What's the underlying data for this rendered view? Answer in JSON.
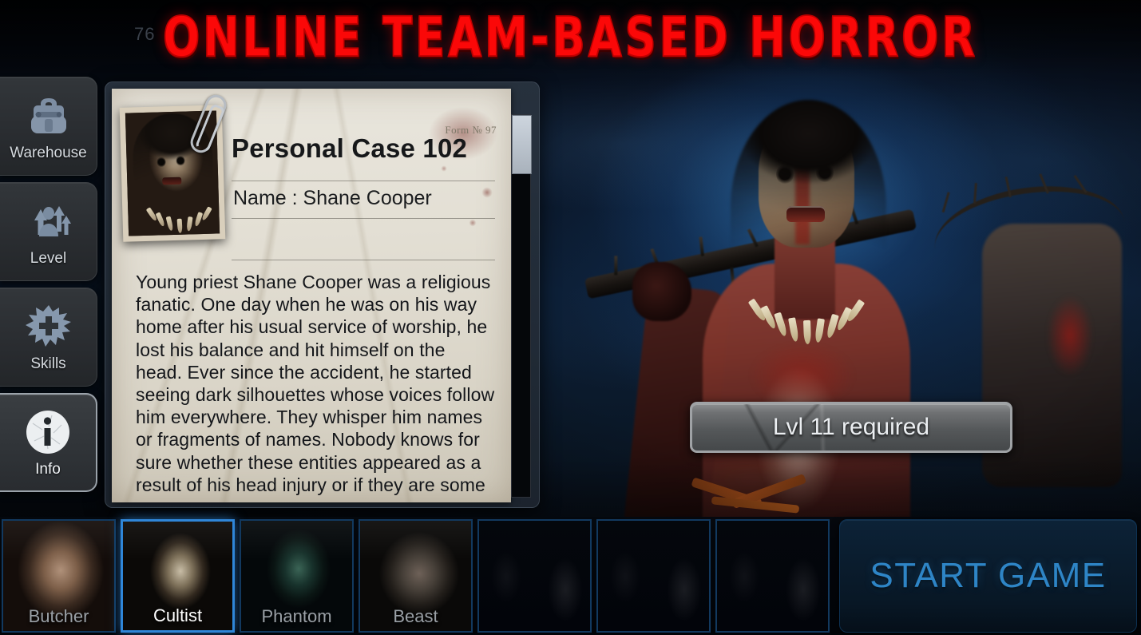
{
  "banner": {
    "title": "ONLINE TEAM-BASED HORROR",
    "counter": "76"
  },
  "sidebar": {
    "items": [
      {
        "label": "Warehouse",
        "icon": "backpack-icon",
        "active": false
      },
      {
        "label": "Level",
        "icon": "level-up-icon",
        "active": false
      },
      {
        "label": "Skills",
        "icon": "skill-splat-plus-icon",
        "active": false
      },
      {
        "label": "Info",
        "icon": "info-circle-icon",
        "active": true
      }
    ]
  },
  "dossier": {
    "case_title": "Personal Case 102",
    "form_number": "Form № 97",
    "name_label": "Name : Shane Cooper",
    "body": "Young priest Shane Cooper was a religious fanatic. One day when he was on his way home after his usual service of worship, he lost his balance and hit himself on the head. Ever since the accident, he started seeing dark silhouettes whose voices follow him everywhere. They whisper him names or fragments of names. Nobody knows for sure whether these entities appeared as a result of his head injury or if they are some kind of demonic force that possessed his consciousness. In the end, the \"dark"
  },
  "level_requirement": {
    "text": "Lvl 11 required"
  },
  "characters": [
    {
      "label": "Butcher",
      "art": "art-butcher",
      "selected": false,
      "locked": false
    },
    {
      "label": "Cultist",
      "art": "art-cultist",
      "selected": true,
      "locked": false
    },
    {
      "label": "Phantom",
      "art": "art-phantom",
      "selected": false,
      "locked": false
    },
    {
      "label": "Beast",
      "art": "art-beast",
      "selected": false,
      "locked": false
    },
    {
      "label": "",
      "art": "art-locked",
      "selected": false,
      "locked": true
    },
    {
      "label": "",
      "art": "art-locked",
      "selected": false,
      "locked": true
    },
    {
      "label": "",
      "art": "art-locked",
      "selected": false,
      "locked": true
    }
  ],
  "start_button": {
    "label": "START GAME"
  },
  "colors": {
    "banner_red": "#fb0808",
    "accent_blue": "#2f86d8",
    "start_text": "#2e85c6",
    "selected_border": "#2f86d8",
    "card_border": "#12395f",
    "paper": "#e9e6dd",
    "plaque_grey": "#6f7173"
  }
}
